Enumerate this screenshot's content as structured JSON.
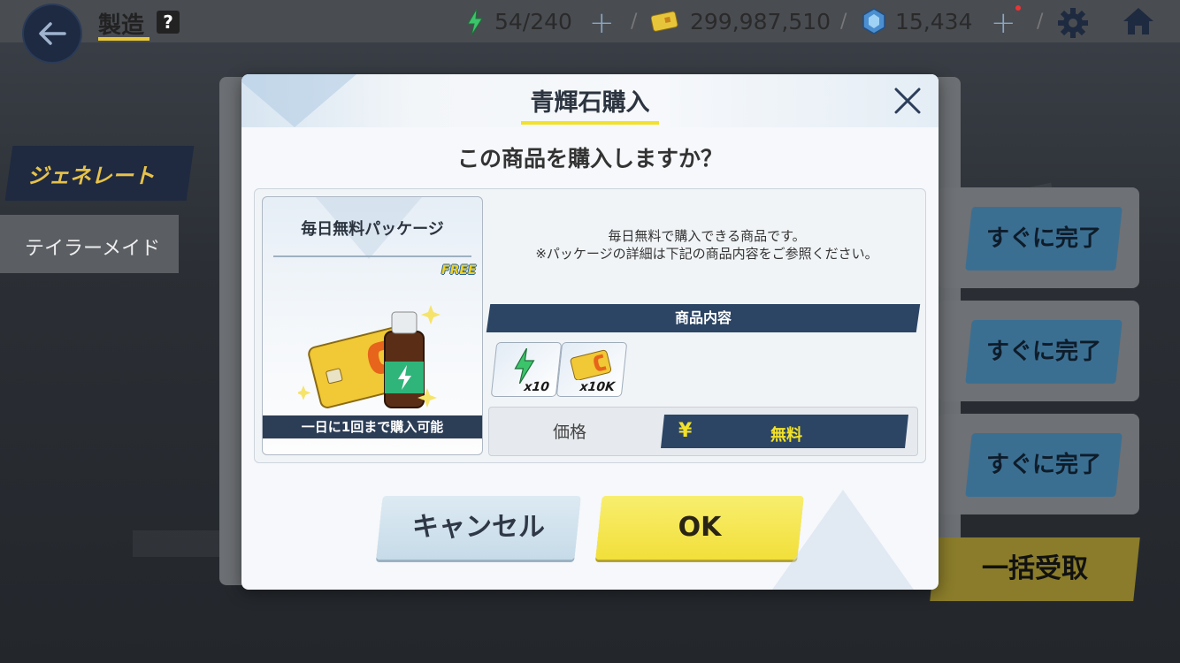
{
  "header": {
    "title": "製造",
    "help": "?",
    "ap": "54/240",
    "credits": "299,987,510",
    "gems": "15,434"
  },
  "side": {
    "tab_generate": "ジェネレート",
    "tab_tailor": "テイラーメイド"
  },
  "right_panel": {
    "instant_complete": [
      "すぐに完了",
      "すぐに完了",
      "すぐに完了"
    ],
    "bulk_receive": "一括受取"
  },
  "modal": {
    "title": "青輝石購入",
    "question": "この商品を購入しますか？",
    "card": {
      "title": "毎日無料パッケージ",
      "badge": "FREE",
      "footer": "一日に1回まで購入可能"
    },
    "description_1": "毎日無料で購入できる商品です。",
    "description_2": "※パッケージの詳細は下記の商品内容をご参照ください。",
    "contents_header": "商品内容",
    "items": [
      {
        "icon": "energy-icon",
        "qty": "x10"
      },
      {
        "icon": "credit-card-icon",
        "qty": "x10K"
      }
    ],
    "price_label": "価格",
    "currency_symbol": "¥",
    "price_value": "無料",
    "cancel_label": "キャンセル",
    "ok_label": "OK"
  },
  "colors": {
    "accent_yellow": "#f2e12a",
    "navy": "#2c4565"
  }
}
